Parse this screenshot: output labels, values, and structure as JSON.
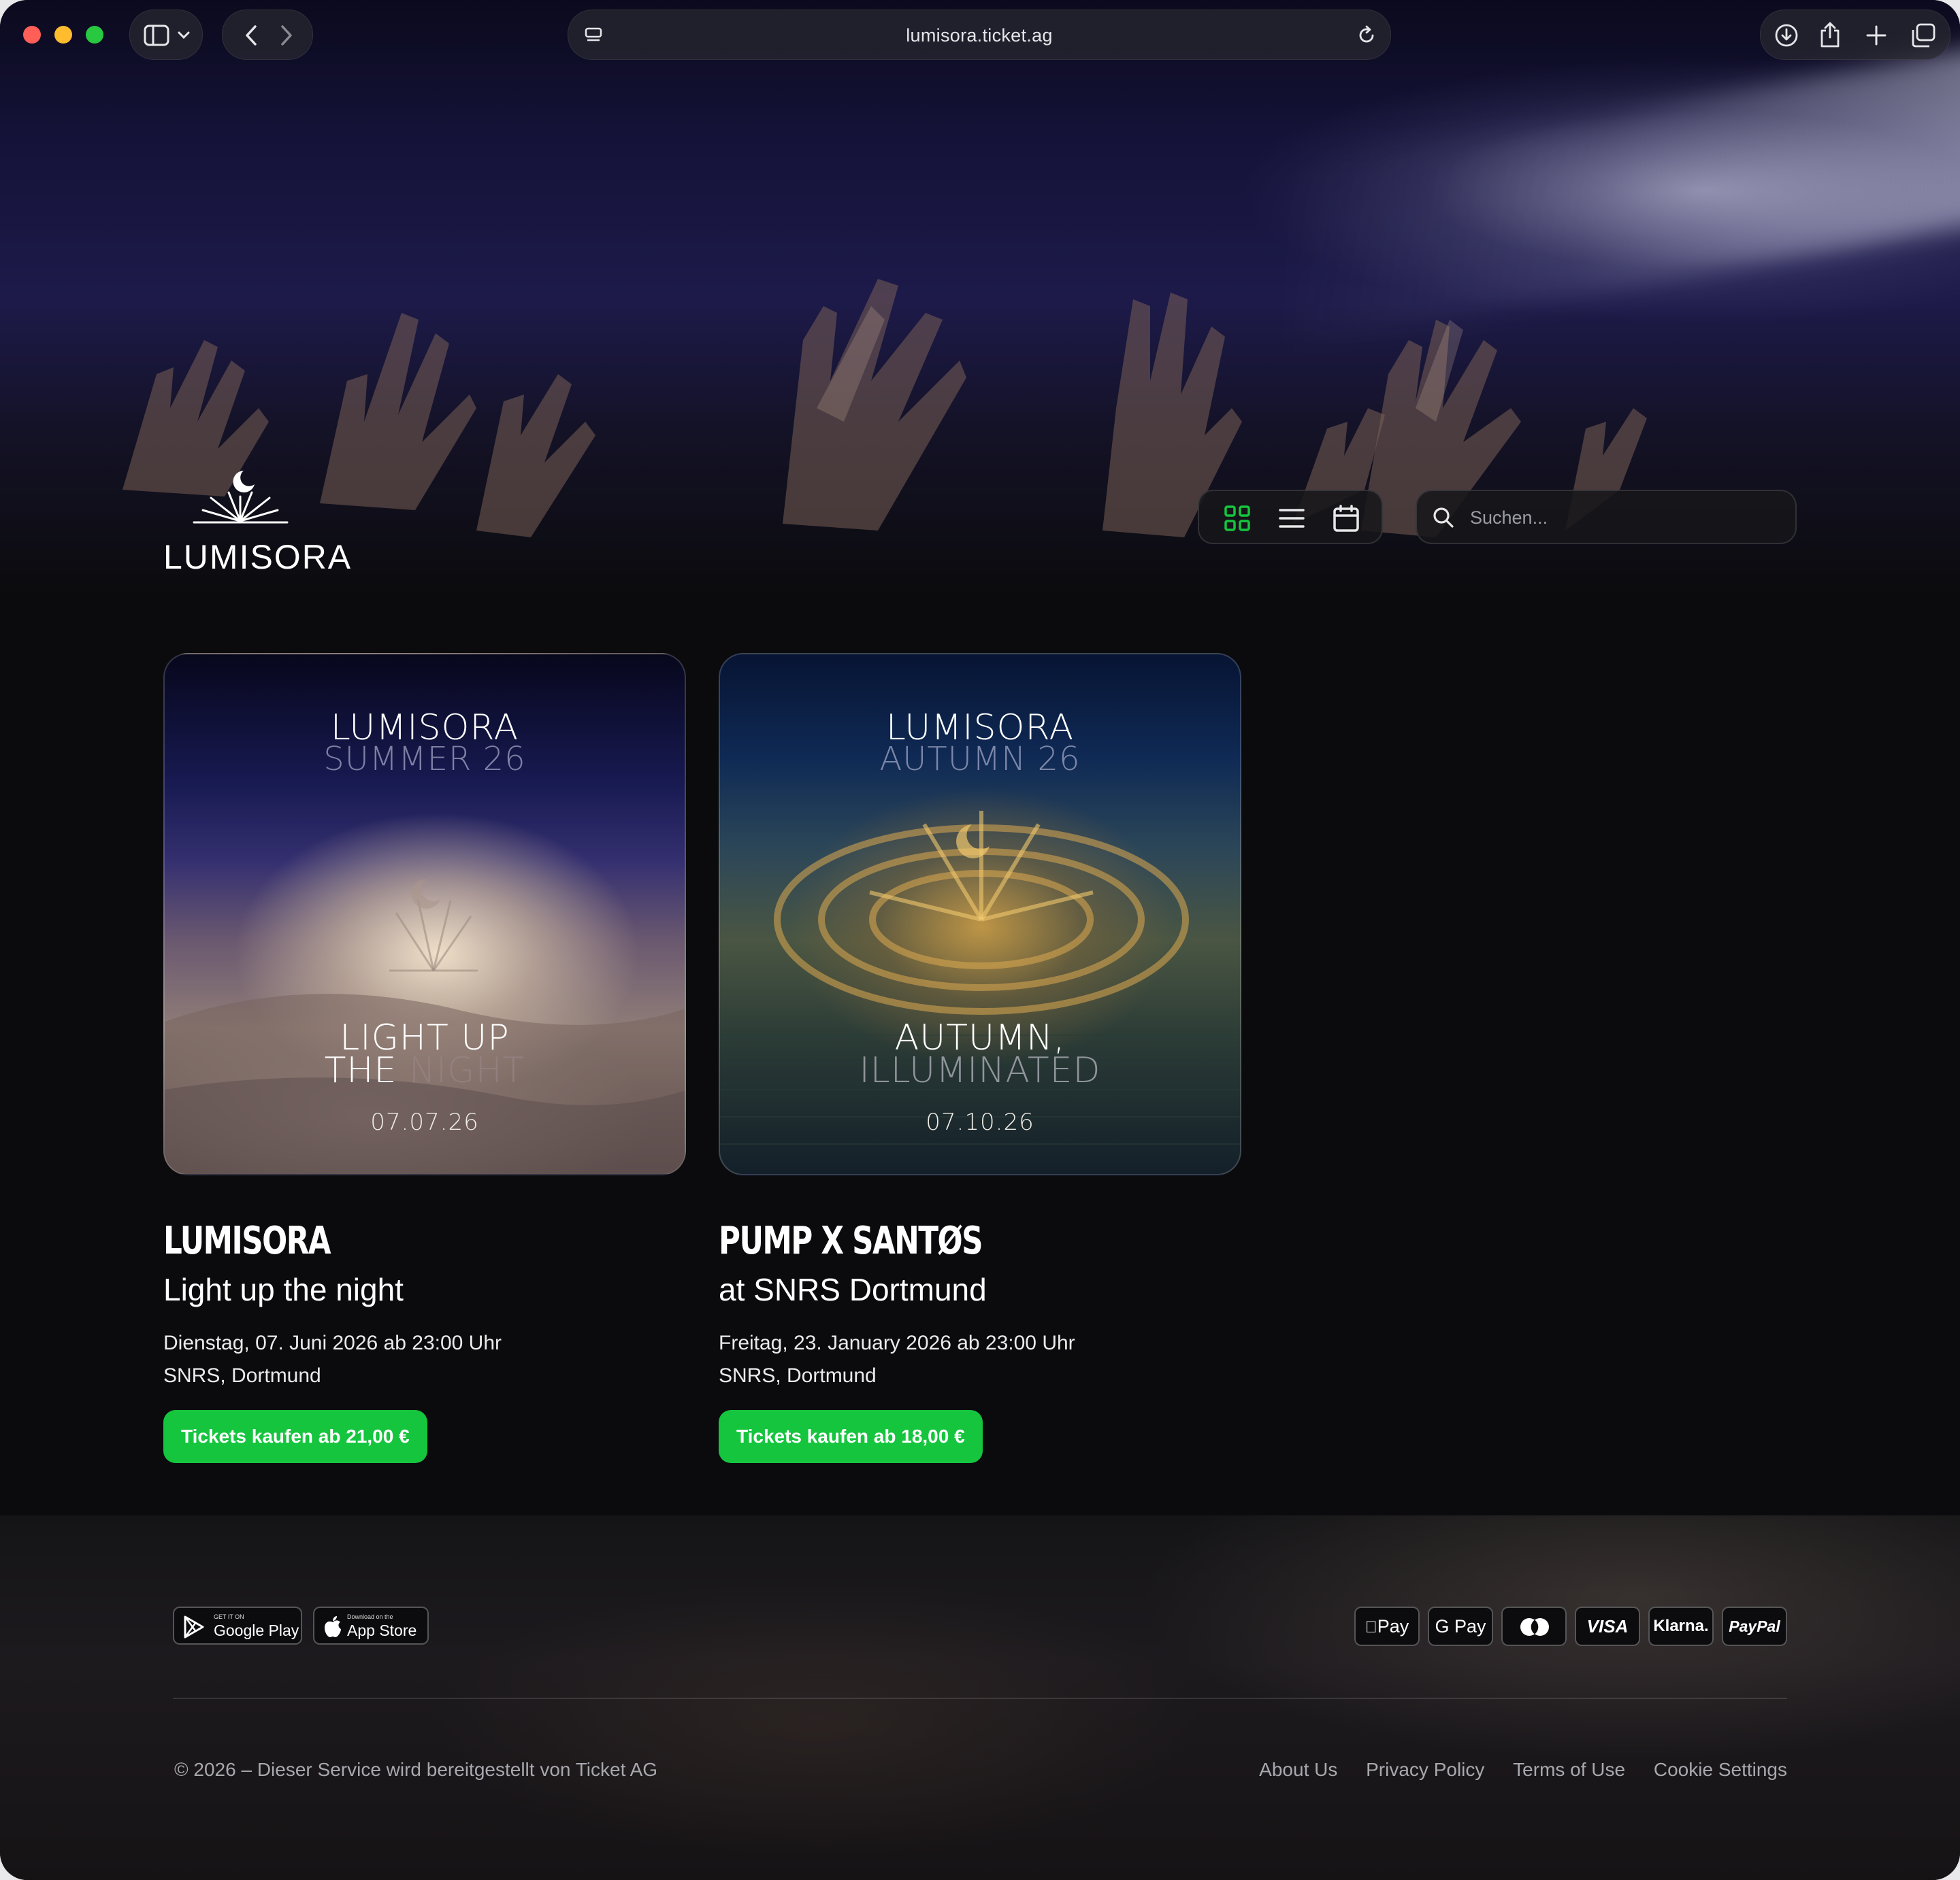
{
  "browser": {
    "url": "lumisora.ticket.ag"
  },
  "header": {
    "logo_text": "LUMISORA",
    "search_placeholder": "Suchen...",
    "view_modes": [
      "grid-view",
      "list-view",
      "calendar-view"
    ],
    "active_view": "grid-view",
    "accent_color": "#15c53e"
  },
  "events": [
    {
      "poster": {
        "brand": "LUMISORA",
        "season": "SUMMER 26",
        "headline_1": "LIGHT UP",
        "headline_2a": "THE",
        "headline_2b": "NIGHT",
        "date": "07.07.26"
      },
      "title": "LUMISORA",
      "subtitle": "Light up the night",
      "datetime": "Dienstag, 07. Juni 2026 ab 23:00 Uhr",
      "venue": "SNRS, Dortmund",
      "button_label": "Tickets kaufen ab 21,00 €"
    },
    {
      "poster": {
        "brand": "LUMISORA",
        "season": "AUTUMN 26",
        "headline_1": "AUTUMN,",
        "headline_2": "ILLUMINATED",
        "date": "07.10.26"
      },
      "title": "PUMP X SANTØS",
      "subtitle": "at SNRS Dortmund",
      "datetime": "Freitag, 23. January 2026 ab 23:00 Uhr",
      "venue": "SNRS, Dortmund",
      "button_label": "Tickets kaufen ab 18,00 €"
    }
  ],
  "footer": {
    "google_play": {
      "small": "GET IT ON",
      "big": "Google Play"
    },
    "app_store": {
      "small": "Download on the",
      "big": "App Store"
    },
    "payment_methods": [
      "Pay",
      "G Pay",
      "mastercard",
      "VISA",
      "Klarna.",
      "PayPal"
    ],
    "copyright": "© 2026 – Dieser Service wird bereitgestellt von Ticket AG",
    "links": [
      "About Us",
      "Privacy Policy",
      "Terms of Use",
      "Cookie Settings"
    ]
  }
}
